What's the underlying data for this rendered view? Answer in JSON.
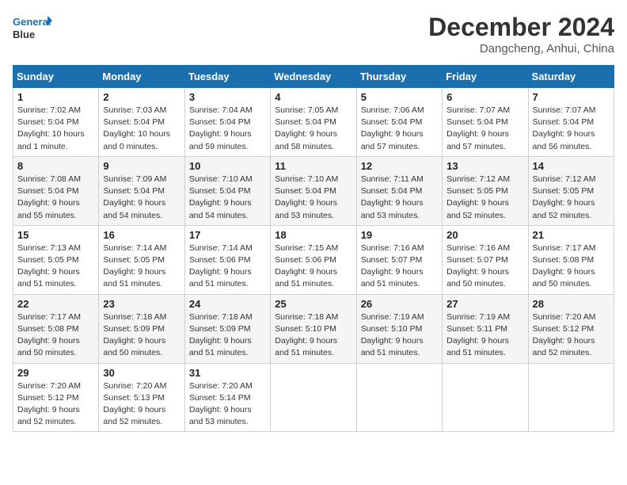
{
  "header": {
    "logo_line1": "General",
    "logo_line2": "Blue",
    "month": "December 2024",
    "location": "Dangcheng, Anhui, China"
  },
  "weekdays": [
    "Sunday",
    "Monday",
    "Tuesday",
    "Wednesday",
    "Thursday",
    "Friday",
    "Saturday"
  ],
  "weeks": [
    [
      {
        "day": "1",
        "detail": "Sunrise: 7:02 AM\nSunset: 5:04 PM\nDaylight: 10 hours\nand 1 minute."
      },
      {
        "day": "2",
        "detail": "Sunrise: 7:03 AM\nSunset: 5:04 PM\nDaylight: 10 hours\nand 0 minutes."
      },
      {
        "day": "3",
        "detail": "Sunrise: 7:04 AM\nSunset: 5:04 PM\nDaylight: 9 hours\nand 59 minutes."
      },
      {
        "day": "4",
        "detail": "Sunrise: 7:05 AM\nSunset: 5:04 PM\nDaylight: 9 hours\nand 58 minutes."
      },
      {
        "day": "5",
        "detail": "Sunrise: 7:06 AM\nSunset: 5:04 PM\nDaylight: 9 hours\nand 57 minutes."
      },
      {
        "day": "6",
        "detail": "Sunrise: 7:07 AM\nSunset: 5:04 PM\nDaylight: 9 hours\nand 57 minutes."
      },
      {
        "day": "7",
        "detail": "Sunrise: 7:07 AM\nSunset: 5:04 PM\nDaylight: 9 hours\nand 56 minutes."
      }
    ],
    [
      {
        "day": "8",
        "detail": "Sunrise: 7:08 AM\nSunset: 5:04 PM\nDaylight: 9 hours\nand 55 minutes."
      },
      {
        "day": "9",
        "detail": "Sunrise: 7:09 AM\nSunset: 5:04 PM\nDaylight: 9 hours\nand 54 minutes."
      },
      {
        "day": "10",
        "detail": "Sunrise: 7:10 AM\nSunset: 5:04 PM\nDaylight: 9 hours\nand 54 minutes."
      },
      {
        "day": "11",
        "detail": "Sunrise: 7:10 AM\nSunset: 5:04 PM\nDaylight: 9 hours\nand 53 minutes."
      },
      {
        "day": "12",
        "detail": "Sunrise: 7:11 AM\nSunset: 5:04 PM\nDaylight: 9 hours\nand 53 minutes."
      },
      {
        "day": "13",
        "detail": "Sunrise: 7:12 AM\nSunset: 5:05 PM\nDaylight: 9 hours\nand 52 minutes."
      },
      {
        "day": "14",
        "detail": "Sunrise: 7:12 AM\nSunset: 5:05 PM\nDaylight: 9 hours\nand 52 minutes."
      }
    ],
    [
      {
        "day": "15",
        "detail": "Sunrise: 7:13 AM\nSunset: 5:05 PM\nDaylight: 9 hours\nand 51 minutes."
      },
      {
        "day": "16",
        "detail": "Sunrise: 7:14 AM\nSunset: 5:05 PM\nDaylight: 9 hours\nand 51 minutes."
      },
      {
        "day": "17",
        "detail": "Sunrise: 7:14 AM\nSunset: 5:06 PM\nDaylight: 9 hours\nand 51 minutes."
      },
      {
        "day": "18",
        "detail": "Sunrise: 7:15 AM\nSunset: 5:06 PM\nDaylight: 9 hours\nand 51 minutes."
      },
      {
        "day": "19",
        "detail": "Sunrise: 7:16 AM\nSunset: 5:07 PM\nDaylight: 9 hours\nand 51 minutes."
      },
      {
        "day": "20",
        "detail": "Sunrise: 7:16 AM\nSunset: 5:07 PM\nDaylight: 9 hours\nand 50 minutes."
      },
      {
        "day": "21",
        "detail": "Sunrise: 7:17 AM\nSunset: 5:08 PM\nDaylight: 9 hours\nand 50 minutes."
      }
    ],
    [
      {
        "day": "22",
        "detail": "Sunrise: 7:17 AM\nSunset: 5:08 PM\nDaylight: 9 hours\nand 50 minutes."
      },
      {
        "day": "23",
        "detail": "Sunrise: 7:18 AM\nSunset: 5:09 PM\nDaylight: 9 hours\nand 50 minutes."
      },
      {
        "day": "24",
        "detail": "Sunrise: 7:18 AM\nSunset: 5:09 PM\nDaylight: 9 hours\nand 51 minutes."
      },
      {
        "day": "25",
        "detail": "Sunrise: 7:18 AM\nSunset: 5:10 PM\nDaylight: 9 hours\nand 51 minutes."
      },
      {
        "day": "26",
        "detail": "Sunrise: 7:19 AM\nSunset: 5:10 PM\nDaylight: 9 hours\nand 51 minutes."
      },
      {
        "day": "27",
        "detail": "Sunrise: 7:19 AM\nSunset: 5:11 PM\nDaylight: 9 hours\nand 51 minutes."
      },
      {
        "day": "28",
        "detail": "Sunrise: 7:20 AM\nSunset: 5:12 PM\nDaylight: 9 hours\nand 52 minutes."
      }
    ],
    [
      {
        "day": "29",
        "detail": "Sunrise: 7:20 AM\nSunset: 5:12 PM\nDaylight: 9 hours\nand 52 minutes."
      },
      {
        "day": "30",
        "detail": "Sunrise: 7:20 AM\nSunset: 5:13 PM\nDaylight: 9 hours\nand 52 minutes."
      },
      {
        "day": "31",
        "detail": "Sunrise: 7:20 AM\nSunset: 5:14 PM\nDaylight: 9 hours\nand 53 minutes."
      },
      null,
      null,
      null,
      null
    ]
  ]
}
